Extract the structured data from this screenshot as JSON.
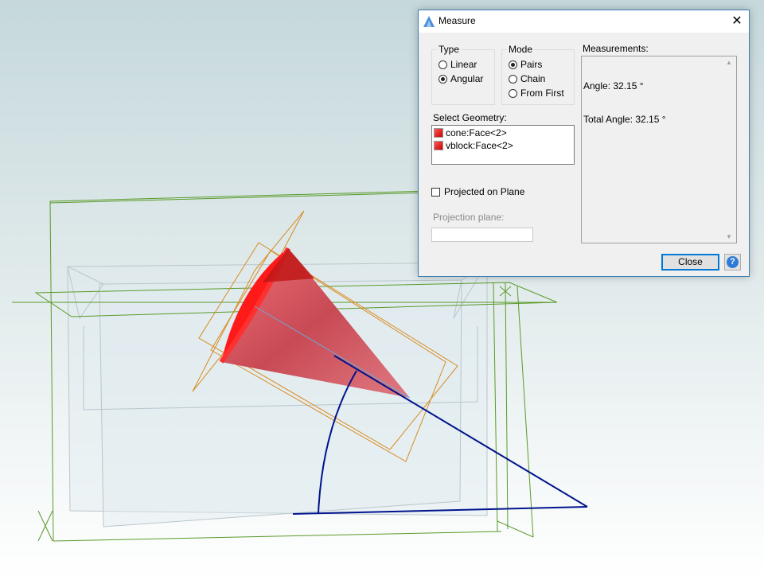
{
  "dialog": {
    "title": "Measure",
    "close_glyph": "✕",
    "type_group": {
      "label": "Type",
      "options": [
        {
          "label": "Linear",
          "selected": false
        },
        {
          "label": "Angular",
          "selected": true
        }
      ]
    },
    "mode_group": {
      "label": "Mode",
      "options": [
        {
          "label": "Pairs",
          "selected": true
        },
        {
          "label": "Chain",
          "selected": false
        },
        {
          "label": "From First",
          "selected": false
        }
      ]
    },
    "select_geometry": {
      "label": "Select Geometry:",
      "items": [
        "cone:Face<2>",
        "vblock:Face<2>"
      ]
    },
    "projected_on_plane": {
      "label": "Projected on Plane",
      "checked": false
    },
    "projection_plane": {
      "label": "Projection plane:",
      "value": ""
    },
    "measurements": {
      "label": "Measurements:",
      "lines": [
        "Angle: 32.15 °",
        "Total Angle: 32.15 °"
      ]
    },
    "close_button": "Close",
    "help_glyph": "?"
  },
  "colors": {
    "cone": "#e8474f",
    "wireframe": "#5a9a2a",
    "plane": "#d98a20",
    "angle": "#00148c",
    "accent": "#0078d7"
  },
  "icons": {
    "app": "app-logo-icon",
    "close": "close-icon",
    "help": "help-icon",
    "geometry": "face-cube-icon"
  }
}
